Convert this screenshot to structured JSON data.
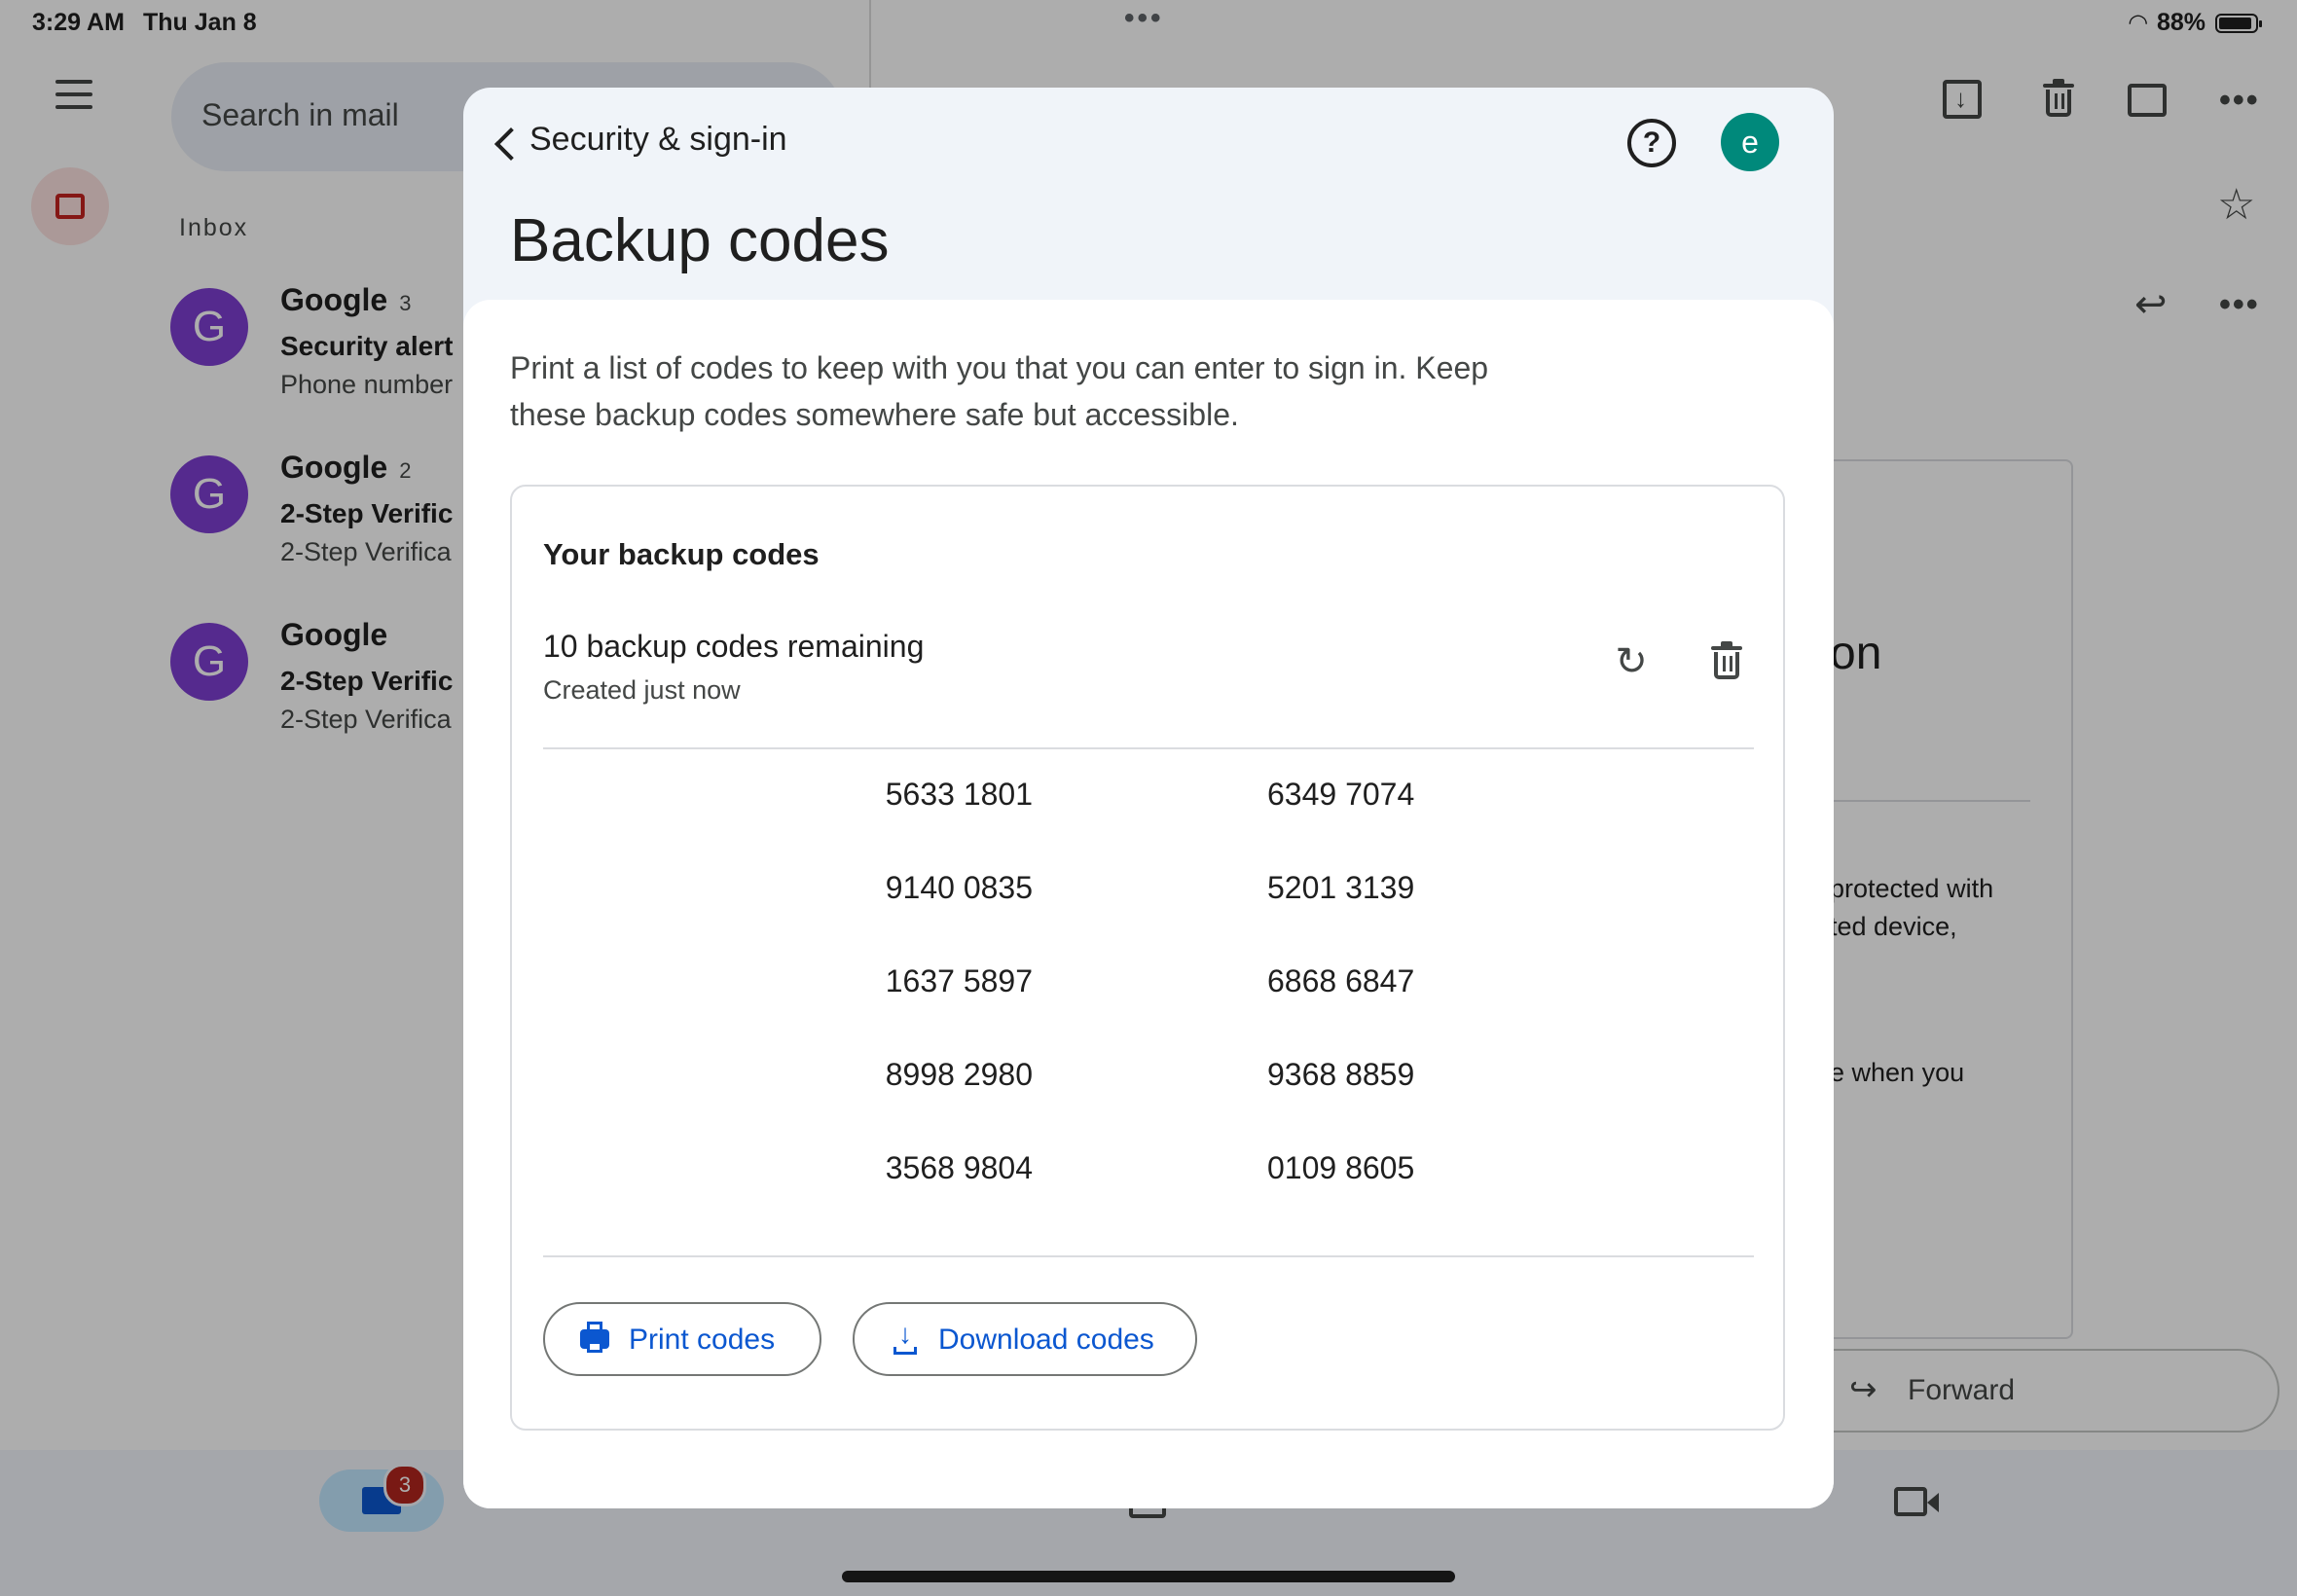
{
  "status_bar": {
    "time": "3:29 AM",
    "date": "Thu Jan 8",
    "dots": "•••",
    "battery_percent": "88%"
  },
  "mail_app": {
    "search_placeholder": "Search in mail",
    "inbox_label": "Inbox",
    "threads": [
      {
        "avatar": "G",
        "sender": "Google",
        "count": "3",
        "subject": "Security alert",
        "preview": "Phone number"
      },
      {
        "avatar": "G",
        "sender": "Google",
        "count": "2",
        "subject": "2-Step Verific",
        "preview": "2-Step Verifica"
      },
      {
        "avatar": "G",
        "sender": "Google",
        "count": "",
        "subject": "2-Step Verific",
        "preview": "2-Step Verifica"
      }
    ],
    "toolbar_more": "•••",
    "star_icon": "☆",
    "reply_icon": "↩",
    "email_fragment": {
      "heading_fragment": "on",
      "line1": "protected with",
      "line2": "ted device,",
      "line3": "e when you"
    },
    "forward_icon": "↪",
    "forward_label": "Forward",
    "mail_badge_count": "3"
  },
  "modal": {
    "back_label": "Security & sign-in",
    "help_glyph": "?",
    "account_initial": "e",
    "account_color": "#00897b",
    "title": "Backup codes",
    "description": "Print a list of codes to keep with you that you can enter to sign in. Keep these backup codes somewhere safe but accessible.",
    "card": {
      "title": "Your backup codes",
      "remaining": "10 backup codes remaining",
      "created": "Created just now",
      "refresh_glyph": "↻",
      "codes_left": [
        "5633 1801",
        "9140 0835",
        "1637 5897",
        "8998 2980",
        "3568 9804"
      ],
      "codes_right": [
        "6349 7074",
        "5201 3139",
        "6868 6847",
        "9368 8859",
        "0109 8605"
      ],
      "print_label": "Print codes",
      "download_label": "Download codes",
      "accent_color": "#0b57d0"
    }
  }
}
